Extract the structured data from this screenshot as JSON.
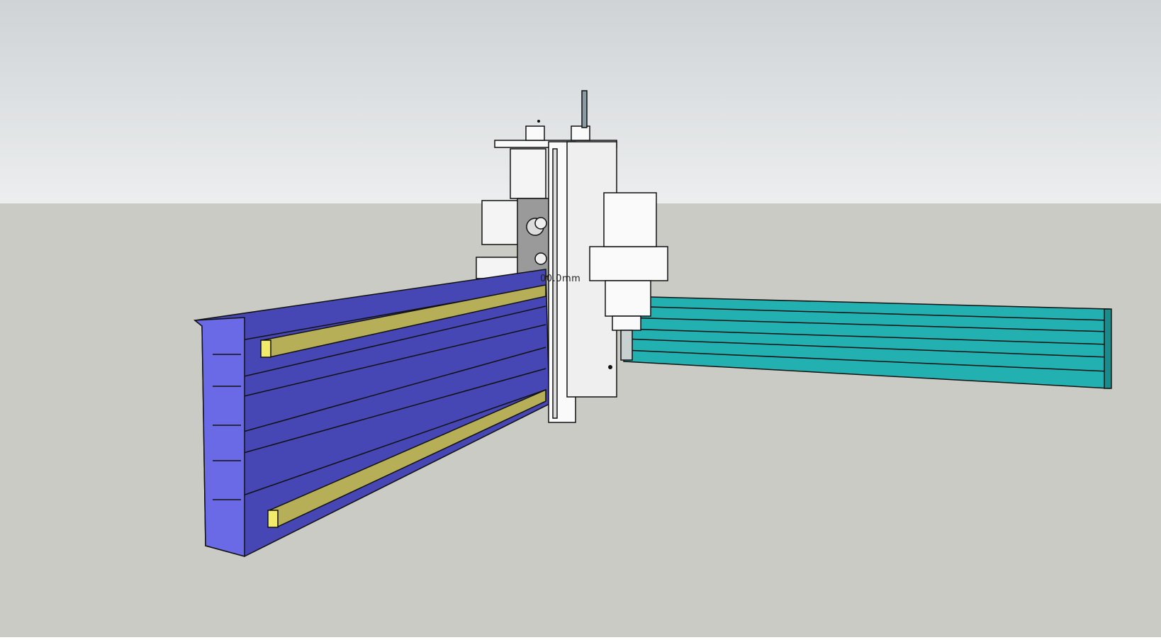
{
  "viewport": {
    "sky_color_top": "#cfd3d6",
    "sky_color_bottom": "#eceeef",
    "ground_color": "#cbcbc6",
    "dimension_label": "00.0mm"
  },
  "model": {
    "x_rail_color": "#4646b4",
    "x_rail_face_color": "#6a6ae6",
    "linear_guide_color": "#b7ae58",
    "linear_guide_end_color": "#f2ec6a",
    "y_rail_color": "#22b0b0",
    "carriage_color": "#ffffff"
  }
}
